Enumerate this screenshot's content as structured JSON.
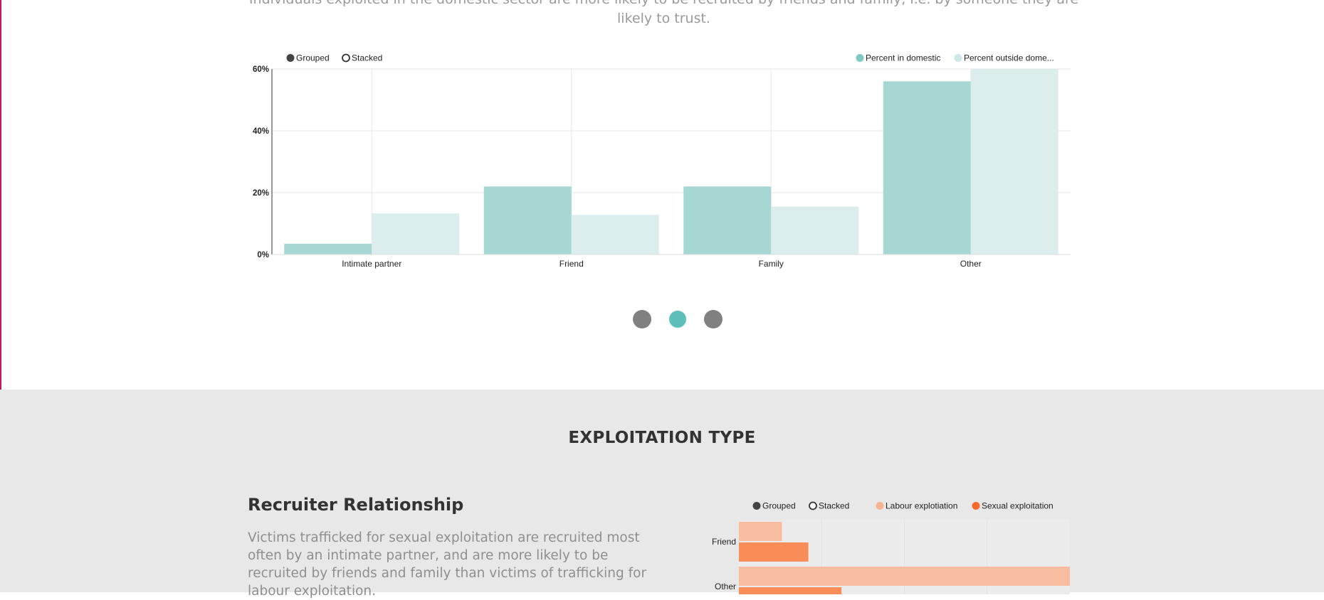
{
  "intro": {
    "text": "Individuals exploited in the domestic sector are more likely to be recruited by friends and family, i.e. by someone they are likely to trust."
  },
  "chart1_controls": {
    "grouped_label": "Grouped",
    "stacked_label": "Stacked"
  },
  "carousel": {
    "slides": 3,
    "active_index": 1
  },
  "colors": {
    "domestic": "#a6d7d3",
    "outside": "#dbeeed",
    "legend_domestic": "#80c8c2",
    "legend_outside": "#cde8e6",
    "labour": "#f8bda0",
    "sexual": "#f98d58",
    "legend_labour": "#f8b394",
    "legend_sexual": "#f76a2c",
    "dot_active": "#5ebfb8",
    "dot_inactive": "#808080",
    "section_bg": "#e8e8e8"
  },
  "section2": {
    "heading": "EXPLOITATION TYPE",
    "subheading": "Recruiter Relationship",
    "body": "Victims trafficked for sexual exploitation are recruited most often by an intimate partner, and are more likely to be recruited by friends and family than victims of trafficking for labour exploitation."
  },
  "chart2_controls": {
    "grouped_label": "Grouped",
    "stacked_label": "Stacked"
  },
  "chart_data": [
    {
      "type": "bar",
      "orientation": "vertical",
      "mode": "grouped",
      "categories": [
        "Intimate partner",
        "Friend",
        "Family",
        "Other"
      ],
      "series": [
        {
          "name": "Percent in domestic",
          "values": [
            3.5,
            22,
            22,
            56
          ]
        },
        {
          "name": "Percent outside dome...",
          "values": [
            13.3,
            12.8,
            15.5,
            60
          ]
        }
      ],
      "ylim": [
        0,
        60
      ],
      "yticks": [
        "0%",
        "20%",
        "40%",
        "60%"
      ],
      "ytick_values": [
        0,
        20,
        40,
        60
      ],
      "grid": true,
      "legend": "top-right"
    },
    {
      "type": "bar",
      "orientation": "horizontal",
      "mode": "grouped",
      "categories": [
        "Friend",
        "Other"
      ],
      "series": [
        {
          "name": "Labour explotiation",
          "values": [
            13,
            100
          ]
        },
        {
          "name": "Sexual exploitation",
          "values": [
            21,
            31
          ]
        }
      ],
      "xlim": [
        0,
        100
      ],
      "grid": true,
      "legend": "top-right"
    }
  ]
}
